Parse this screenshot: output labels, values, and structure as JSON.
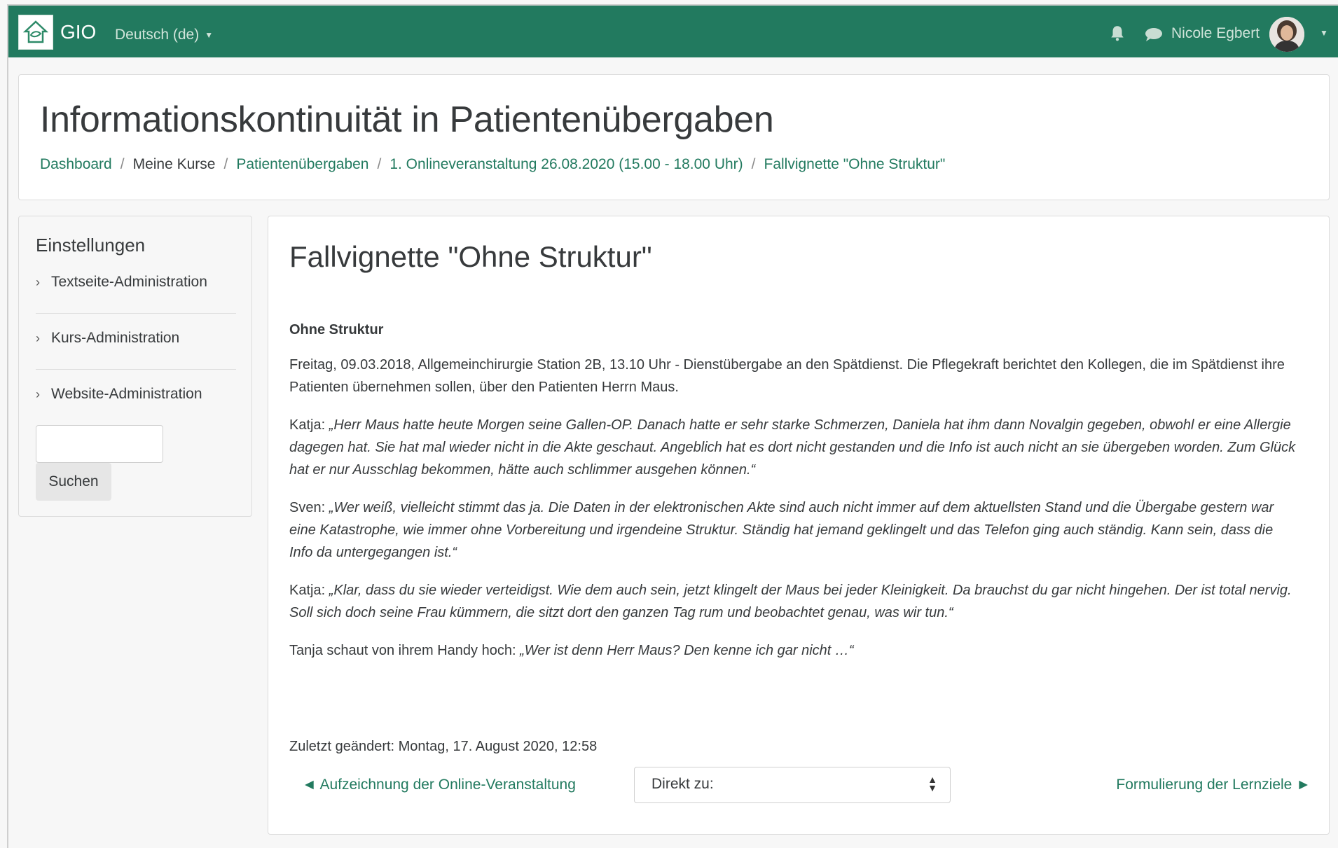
{
  "navbar": {
    "brand": "GIO",
    "language": "Deutsch (de)",
    "user_name": "Nicole Egbert"
  },
  "header": {
    "title": "Informationskontinuität in Patientenübergaben",
    "breadcrumb": [
      {
        "label": "Dashboard",
        "link": true
      },
      {
        "label": "Meine Kurse",
        "link": false
      },
      {
        "label": "Patientenübergaben",
        "link": true
      },
      {
        "label": "1. Onlineveranstaltung 26.08.2020 (15.00 - 18.00 Uhr)",
        "link": true
      },
      {
        "label": "Fallvignette \"Ohne Struktur\"",
        "link": true
      }
    ]
  },
  "sidebar": {
    "title": "Einstellungen",
    "items": [
      {
        "label": "Textseite-Administration"
      },
      {
        "label": "Kurs-Administration"
      },
      {
        "label": "Website-Administration"
      }
    ],
    "search_button": "Suchen"
  },
  "main": {
    "title": "Fallvignette \"Ohne Struktur\"",
    "subheading": "Ohne Struktur",
    "intro": "Freitag, 09.03.2018, Allgemeinchirurgie Station 2B, 13.10 Uhr -  Dienstübergabe an den Spätdienst. Die Pflegekraft berichtet den Kollegen, die im Spätdienst ihre Patienten übernehmen sollen, über den Patienten Herrn Maus.",
    "quotes": [
      {
        "speaker": "Katja:",
        "text": "„Herr Maus hatte heute Morgen seine Gallen-OP. Danach hatte er sehr starke Schmerzen, Daniela hat ihm dann Novalgin gegeben, obwohl er eine Allergie dagegen hat. Sie hat mal wieder nicht in die Akte geschaut. Angeblich hat es dort nicht gestanden und die Info ist auch nicht an sie übergeben worden. Zum Glück hat er nur Ausschlag bekommen, hätte auch schlimmer ausgehen können.“"
      },
      {
        "speaker": "Sven:",
        "text": "„Wer weiß, vielleicht stimmt das ja. Die Daten in der elektronischen Akte sind auch nicht immer auf dem aktuellsten Stand und die Übergabe gestern war eine Katastrophe, wie immer ohne Vorbereitung und irgendeine Struktur. Ständig hat jemand geklingelt und das Telefon ging auch ständig. Kann sein, dass die Info da untergegangen ist.“"
      },
      {
        "speaker": "Katja:",
        "text": "„Klar, dass du sie wieder verteidigst. Wie dem auch sein, jetzt klingelt der Maus bei jeder Kleinigkeit. Da brauchst du gar nicht hingehen. Der ist total nervig. Soll sich doch seine Frau kümmern, die sitzt dort den ganzen Tag rum und beobachtet genau, was wir tun.“"
      },
      {
        "speaker": "Tanja schaut von ihrem Handy hoch:",
        "text": "„Wer ist denn Herr Maus? Den kenne ich gar nicht …“"
      }
    ],
    "modified": "Zuletzt geändert: Montag, 17. August 2020, 12:58",
    "prev_link": "Aufzeichnung der Online-Veranstaltung",
    "jump_select": "Direkt zu:",
    "next_link": "Formulierung der Lernziele"
  }
}
